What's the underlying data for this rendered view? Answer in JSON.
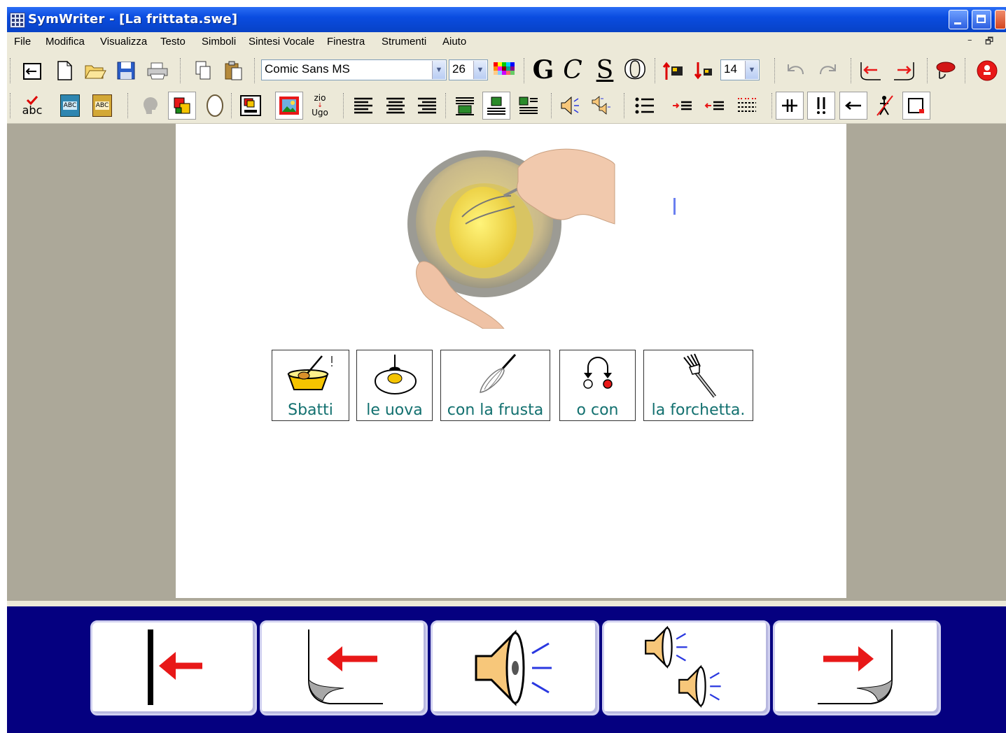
{
  "window": {
    "title": "SymWriter - [La frittata.swe]"
  },
  "menu": {
    "items": [
      "File",
      "Modifica",
      "Visualizza",
      "Testo",
      "Simboli",
      "Sintesi Vocale",
      "Finestra",
      "Strumenti",
      "Aiuto"
    ]
  },
  "toolbar": {
    "font_name": "Comic Sans MS",
    "font_size": "26",
    "symbol_size": "14",
    "bold_label": "G",
    "italic_label": "C",
    "underline_label": "S",
    "outline_label": "O",
    "spell_label": "abc",
    "abc_label": "ABC",
    "zio_label": "zio",
    "ugo_label": "Ugo"
  },
  "document": {
    "symbols": [
      {
        "label": "Sbatti",
        "icon": "whisk-bowl-icon"
      },
      {
        "label": "le uova",
        "icon": "egg-icon"
      },
      {
        "label": "con la frusta",
        "icon": "whisk-icon"
      },
      {
        "label": "o con",
        "icon": "or-icon"
      },
      {
        "label": "la forchetta.",
        "icon": "fork-icon"
      }
    ]
  },
  "bottom_buttons": [
    {
      "name": "go-to-start-button",
      "icon": "arrow-to-start-icon"
    },
    {
      "name": "previous-line-button",
      "icon": "return-left-icon"
    },
    {
      "name": "speak-button",
      "icon": "speaker-icon"
    },
    {
      "name": "speak-all-button",
      "icon": "speakers-icon"
    },
    {
      "name": "next-line-button",
      "icon": "return-right-icon"
    }
  ],
  "colors": {
    "title_bar": "#0a4ce0",
    "symbol_label": "#12706f",
    "bottom_panel": "#050080",
    "arrow": "#e81818"
  }
}
